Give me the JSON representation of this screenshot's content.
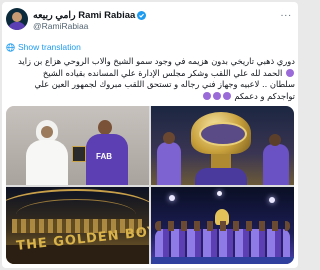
{
  "author": {
    "display_name": "رامي ربيعه Rami Rabiaa",
    "handle": "@RamiRabiaa"
  },
  "actions": {
    "translate_label": "Show translation",
    "more_label": "..."
  },
  "tweet": {
    "line1": "دوري ذهبي تاريخي بدون هزيمه في وجود سمو الشيخ والاب الروحي هزاع بن زايد",
    "line2": "الحمد لله علي اللقب وشكر مجلس الإدارة علي المسانده بقياده الشيخ",
    "line3": "سلطان .. لاعبيه وجهاز فني رجاله و تستحق اللقب مبروك لجمهور العين علي",
    "line4": "تواجدكم و دعمكم"
  },
  "media": {
    "banner_text": "THE GOLDEN BOYS",
    "jersey_text": "FAB"
  },
  "colors": {
    "link_blue": "#1d9bf0",
    "club_purple": "#5b3fb3",
    "gold": "#d9b34a"
  },
  "icons": [
    "verified-icon",
    "more-icon",
    "globe-icon"
  ]
}
